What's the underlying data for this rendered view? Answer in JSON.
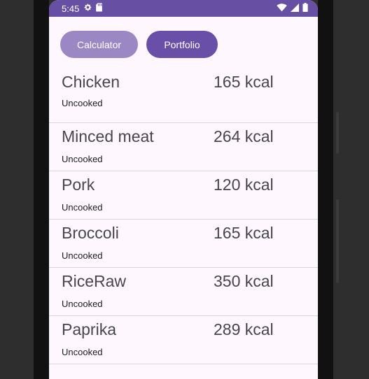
{
  "status_bar": {
    "time": "5:45",
    "left_icons": [
      "gear-icon",
      "sd-card-icon"
    ],
    "right_icons": [
      "wifi-icon",
      "signal-icon",
      "battery-icon"
    ]
  },
  "tabs": [
    {
      "label": "Calculator",
      "selected": false
    },
    {
      "label": "Portfolio",
      "selected": true
    }
  ],
  "foods": [
    {
      "name": "Chicken",
      "state": "Uncooked",
      "kcal": "165 kcal"
    },
    {
      "name": "Minced meat",
      "state": "Uncooked",
      "kcal": "264 kcal"
    },
    {
      "name": "Pork",
      "state": "Uncooked",
      "kcal": "120 kcal"
    },
    {
      "name": "Broccoli",
      "state": "Uncooked",
      "kcal": "165 kcal"
    },
    {
      "name": "RiceRaw",
      "state": "Uncooked",
      "kcal": "350 kcal"
    },
    {
      "name": "Paprika",
      "state": "Uncooked",
      "kcal": "289 kcal"
    }
  ],
  "colors": {
    "status_bar": "#6750a4",
    "tab_selected": "#6a4fa8",
    "tab_unselected": "#9b87c4",
    "background": "#fef7fe"
  }
}
